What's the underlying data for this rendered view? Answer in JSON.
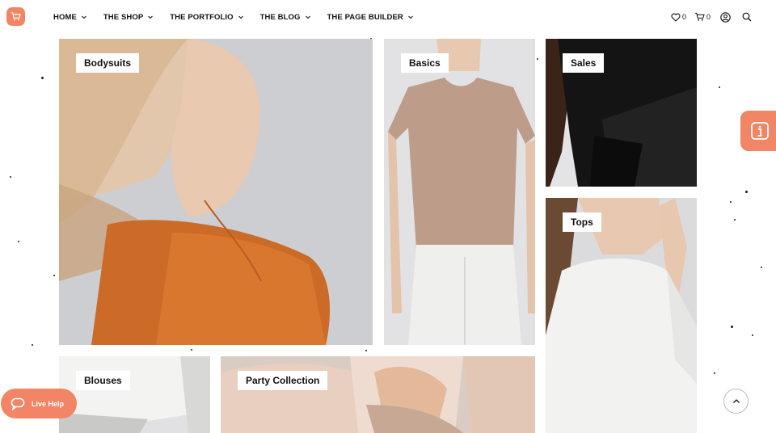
{
  "header": {
    "logo_icon": "cart-icon",
    "nav": [
      {
        "label": "HOME"
      },
      {
        "label": "THE SHOP"
      },
      {
        "label": "THE PORTFOLIO"
      },
      {
        "label": "THE BLOG"
      },
      {
        "label": "THE PAGE BUILDER"
      }
    ],
    "wishlist_count": "0",
    "cart_count": "0",
    "icons": [
      "heart-icon",
      "cart-icon",
      "user-icon",
      "search-icon"
    ]
  },
  "categories": [
    {
      "label": "Bodysuits"
    },
    {
      "label": "Basics"
    },
    {
      "label": "Sales"
    },
    {
      "label": "Tops"
    },
    {
      "label": "Blouses"
    },
    {
      "label": "Party Collection"
    }
  ],
  "live_help": {
    "label": "Live Help"
  },
  "colors": {
    "accent": "#f28566"
  }
}
